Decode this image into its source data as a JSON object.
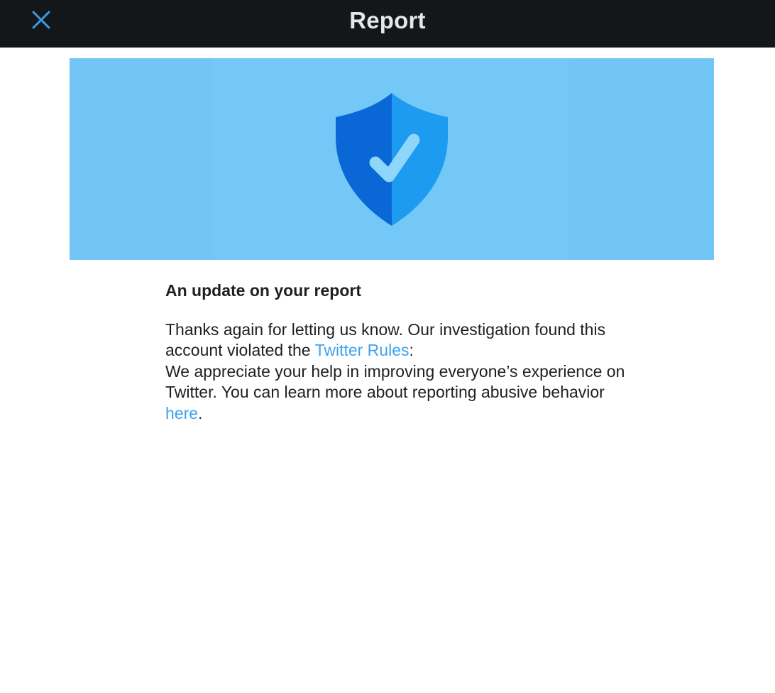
{
  "header": {
    "title": "Report",
    "close_icon": "close-icon",
    "close_icon_color": "#3b9ce8",
    "background": "#14171a"
  },
  "banner": {
    "background": "#71c6f6",
    "icon": "shield-check-icon",
    "shield_colors": {
      "left": "#0a67d6",
      "right": "#1d9bf0",
      "check": "#8fd6fb"
    }
  },
  "message": {
    "heading": "An update on your report",
    "line1_prefix": "Thanks again for letting us know. Our investigation found this account violated the ",
    "rules_link": "Twitter Rules",
    "line1_suffix": ":",
    "line2_prefix": "We appreciate your help in improving everyone’s experience on Twitter. You can learn more about reporting abusive behavior ",
    "here_link": "here",
    "line2_suffix": ".",
    "link_color": "#3ea3ec"
  }
}
